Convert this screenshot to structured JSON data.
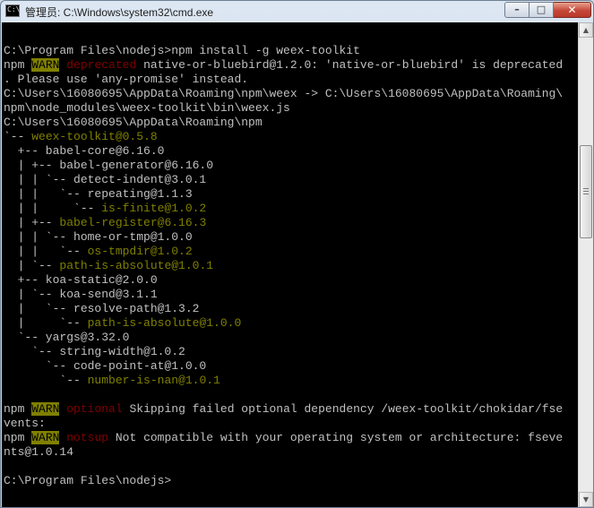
{
  "window": {
    "title": "管理员: C:\\Windows\\system32\\cmd.exe",
    "buttons": {
      "minimize": "–",
      "maximize": "□",
      "close": "✕"
    }
  },
  "console": {
    "lines": [
      {
        "segments": [
          {
            "text": "",
            "color": "g"
          }
        ]
      },
      {
        "segments": [
          {
            "text": "C:\\Program Files\\nodejs>npm install -g weex-toolkit",
            "color": "g"
          }
        ]
      },
      {
        "segments": [
          {
            "text": "npm ",
            "color": "g"
          },
          {
            "text": "WARN",
            "color": "warn"
          },
          {
            "text": " ",
            "color": "g"
          },
          {
            "text": "deprecated",
            "color": "r"
          },
          {
            "text": " native-or-bluebird@1.2.0: 'native-or-bluebird' is deprecated",
            "color": "g"
          }
        ]
      },
      {
        "segments": [
          {
            "text": ". Please use 'any-promise' instead.",
            "color": "g"
          }
        ]
      },
      {
        "segments": [
          {
            "text": "C:\\Users\\16080695\\AppData\\Roaming\\npm\\weex -> C:\\Users\\16080695\\AppData\\Roaming\\",
            "color": "g"
          }
        ]
      },
      {
        "segments": [
          {
            "text": "npm\\node_modules\\weex-toolkit\\bin\\weex.js",
            "color": "g"
          }
        ]
      },
      {
        "segments": [
          {
            "text": "C:\\Users\\16080695\\AppData\\Roaming\\npm",
            "color": "g"
          }
        ]
      },
      {
        "segments": [
          {
            "text": "`-- ",
            "color": "g"
          },
          {
            "text": "weex-toolkit@0.5.8",
            "color": "y"
          }
        ]
      },
      {
        "segments": [
          {
            "text": "  +-- babel-core@6.16.0",
            "color": "g"
          }
        ]
      },
      {
        "segments": [
          {
            "text": "  | +-- babel-generator@6.16.0",
            "color": "g"
          }
        ]
      },
      {
        "segments": [
          {
            "text": "  | | `-- detect-indent@3.0.1",
            "color": "g"
          }
        ]
      },
      {
        "segments": [
          {
            "text": "  | |   `-- repeating@1.1.3",
            "color": "g"
          }
        ]
      },
      {
        "segments": [
          {
            "text": "  | |     `-- ",
            "color": "g"
          },
          {
            "text": "is-finite@1.0.2",
            "color": "y"
          }
        ]
      },
      {
        "segments": [
          {
            "text": "  | +-- ",
            "color": "g"
          },
          {
            "text": "babel-register@6.16.3",
            "color": "y"
          }
        ]
      },
      {
        "segments": [
          {
            "text": "  | | `-- home-or-tmp@1.0.0",
            "color": "g"
          }
        ]
      },
      {
        "segments": [
          {
            "text": "  | |   `-- ",
            "color": "g"
          },
          {
            "text": "os-tmpdir@1.0.2",
            "color": "y"
          }
        ]
      },
      {
        "segments": [
          {
            "text": "  | `-- ",
            "color": "g"
          },
          {
            "text": "path-is-absolute@1.0.1",
            "color": "y"
          }
        ]
      },
      {
        "segments": [
          {
            "text": "  +-- koa-static@2.0.0",
            "color": "g"
          }
        ]
      },
      {
        "segments": [
          {
            "text": "  | `-- koa-send@3.1.1",
            "color": "g"
          }
        ]
      },
      {
        "segments": [
          {
            "text": "  |   `-- resolve-path@1.3.2",
            "color": "g"
          }
        ]
      },
      {
        "segments": [
          {
            "text": "  |     `-- ",
            "color": "g"
          },
          {
            "text": "path-is-absolute@1.0.0",
            "color": "y"
          }
        ]
      },
      {
        "segments": [
          {
            "text": "  `-- yargs@3.32.0",
            "color": "g"
          }
        ]
      },
      {
        "segments": [
          {
            "text": "    `-- string-width@1.0.2",
            "color": "g"
          }
        ]
      },
      {
        "segments": [
          {
            "text": "      `-- code-point-at@1.0.0",
            "color": "g"
          }
        ]
      },
      {
        "segments": [
          {
            "text": "        `-- ",
            "color": "g"
          },
          {
            "text": "number-is-nan@1.0.1",
            "color": "y"
          }
        ]
      },
      {
        "segments": [
          {
            "text": "",
            "color": "g"
          }
        ]
      },
      {
        "segments": [
          {
            "text": "npm ",
            "color": "g"
          },
          {
            "text": "WARN",
            "color": "warn"
          },
          {
            "text": " ",
            "color": "g"
          },
          {
            "text": "optional",
            "color": "r"
          },
          {
            "text": " Skipping failed optional dependency /weex-toolkit/chokidar/fse",
            "color": "g"
          }
        ]
      },
      {
        "segments": [
          {
            "text": "vents:",
            "color": "g"
          }
        ]
      },
      {
        "segments": [
          {
            "text": "npm ",
            "color": "g"
          },
          {
            "text": "WARN",
            "color": "warn"
          },
          {
            "text": " ",
            "color": "g"
          },
          {
            "text": "notsup",
            "color": "r"
          },
          {
            "text": " Not compatible with your operating system or architecture: fseve",
            "color": "g"
          }
        ]
      },
      {
        "segments": [
          {
            "text": "nts@1.0.14",
            "color": "g"
          }
        ]
      },
      {
        "segments": [
          {
            "text": "",
            "color": "g"
          }
        ]
      },
      {
        "segments": [
          {
            "text": "C:\\Program Files\\nodejs>",
            "color": "g"
          }
        ]
      }
    ]
  },
  "scrollbar": {
    "up_arrow": "▲",
    "down_arrow": "▼"
  }
}
